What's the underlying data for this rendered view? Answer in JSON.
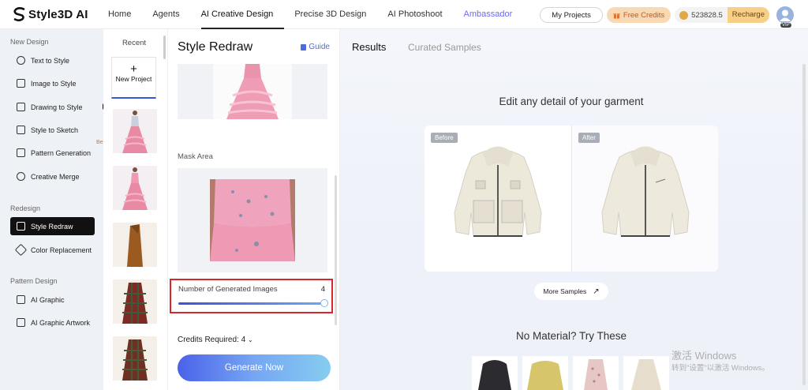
{
  "brand": {
    "name": "Style3D AI"
  },
  "nav": {
    "items": [
      "Home",
      "Agents",
      "AI Creative Design",
      "Precise 3D Design",
      "AI Photoshoot",
      "Ambassador"
    ],
    "active": "AI Creative Design"
  },
  "topbar": {
    "my_projects": "My Projects",
    "free_credits": "Free Credits",
    "credits_value": "523828.5",
    "recharge": "Recharge",
    "vip": "VIP"
  },
  "sidebar": {
    "section_new": "New Design",
    "new_items": [
      "Text to Style",
      "Image to Style",
      "Drawing to Style",
      "Style to Sketch",
      "Pattern Generation",
      "Creative Merge"
    ],
    "beta": "Beta",
    "section_redesign": "Redesign",
    "redesign_items": [
      "Style Redraw",
      "Color Replacement"
    ],
    "section_pattern": "Pattern Design",
    "pattern_items": [
      "AI Graphic",
      "AI Graphic Artwork"
    ],
    "active": "Style Redraw"
  },
  "recent": {
    "title": "Recent",
    "new_project": "New Project"
  },
  "panel": {
    "title": "Style Redraw",
    "guide": "Guide",
    "mask_label": "Mask Area",
    "generated_label": "Number of Generated Images",
    "generated_value": "4",
    "slider_fraction": 1.0,
    "credits_required": "Credits Required: 4",
    "generate": "Generate Now"
  },
  "results": {
    "tabs": [
      "Results",
      "Curated Samples"
    ],
    "active_tab": "Results",
    "headline": "Edit any detail of your garment",
    "before": "Before",
    "after": "After",
    "more_samples": "More Samples",
    "no_material": "No Material? Try These"
  },
  "watermark": {
    "line1": "激活 Windows",
    "line2": "转到\"设置\"以激活 Windows。"
  },
  "colors": {
    "accent": "#3559d4",
    "highlight": "#d8262d",
    "gradient_start": "#4a62ea",
    "gradient_end": "#86cdf0"
  }
}
